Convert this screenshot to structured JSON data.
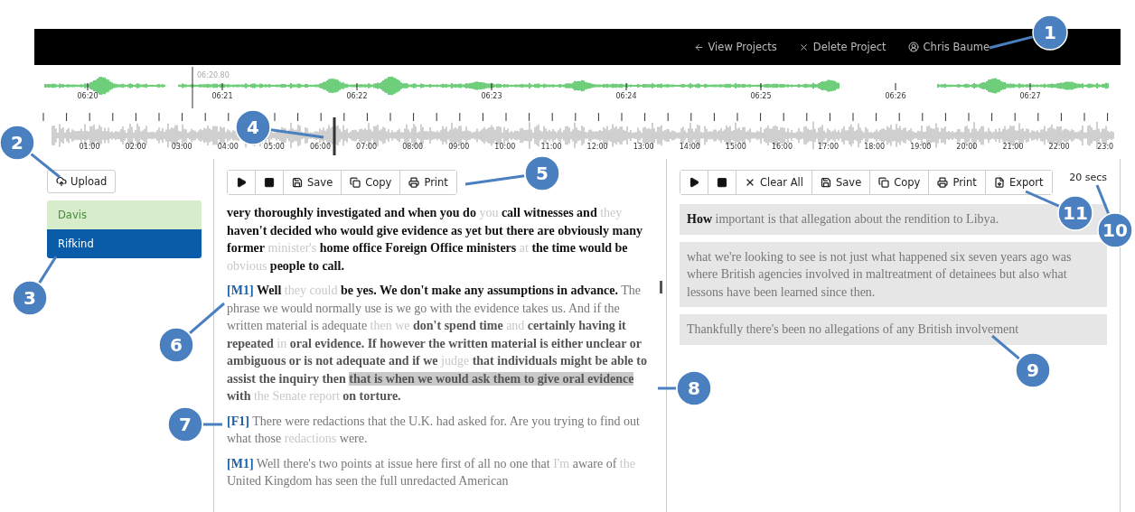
{
  "header": {
    "links": [
      {
        "kind": "back",
        "label": "View Projects"
      },
      {
        "kind": "delete",
        "label": "Delete Project"
      },
      {
        "kind": "user",
        "label": "Chris Baume"
      }
    ]
  },
  "overview": {
    "playhead_time": "06:20.80",
    "ticks": [
      "06:20",
      "06:21",
      "06:22",
      "06:23",
      "06:24",
      "06:25",
      "06:26",
      "06:27"
    ]
  },
  "timeline": {
    "ticks": [
      "01:00",
      "02:00",
      "03:00",
      "04:00",
      "05:00",
      "06:00",
      "07:00",
      "08:00",
      "09:00",
      "10:00",
      "11:00",
      "12:00",
      "13:00",
      "14:00",
      "15:00",
      "16:00",
      "17:00",
      "18:00",
      "19:00",
      "20:00",
      "21:00",
      "22:00",
      "23:0"
    ]
  },
  "upload_button": "Upload",
  "speakers": [
    {
      "name": "Davis",
      "selected": false
    },
    {
      "name": "Rifkind",
      "selected": true
    }
  ],
  "transcript": {
    "toolbar": [
      {
        "kind": "play"
      },
      {
        "kind": "stop"
      },
      {
        "kind": "save",
        "label": "Save"
      },
      {
        "kind": "copy",
        "label": "Copy"
      },
      {
        "kind": "print",
        "label": "Print"
      }
    ],
    "paragraphs": [
      {
        "segments": [
          {
            "kind": "strong",
            "text": "very thoroughly investigated and when you do"
          },
          {
            "kind": "faint",
            "text": "you"
          },
          {
            "kind": "strong",
            "text": "call witnesses and"
          },
          {
            "kind": "faint",
            "text": "they"
          },
          {
            "kind": "strong",
            "text": "haven't decided who would give evidence as yet but there are obviously many former"
          },
          {
            "kind": "faint",
            "text": "minister's"
          },
          {
            "kind": "strong",
            "text": "home office Foreign Office ministers"
          },
          {
            "kind": "faint",
            "text": "at"
          },
          {
            "kind": "strong",
            "text": "the time would be"
          },
          {
            "kind": "faint",
            "text": "obvious"
          },
          {
            "kind": "strong",
            "text": "people to call."
          }
        ]
      },
      {
        "speaker": "[M1]",
        "segments": [
          {
            "kind": "strong",
            "text": "Well"
          },
          {
            "kind": "faint",
            "text": "they could"
          },
          {
            "kind": "strong",
            "text": "be yes. We don't make any assumptions in advance."
          },
          {
            "kind": "normal",
            "text": "The phrase we would normally use is we go with the evidence takes us. And if the written material is adequate"
          },
          {
            "kind": "faint",
            "text": "then we"
          },
          {
            "kind": "medium",
            "text": "don't spend time"
          },
          {
            "kind": "faint",
            "text": "and"
          },
          {
            "kind": "medium",
            "text": "certainly having it repeated"
          },
          {
            "kind": "faint",
            "text": "in"
          },
          {
            "kind": "medium",
            "text": "oral evidence. If however the written material is either unclear or ambiguous or is not adequate and if we"
          },
          {
            "kind": "faint",
            "text": "judge"
          },
          {
            "kind": "medium",
            "text": "that individuals might be able to assist the inquiry then"
          },
          {
            "kind": "highlight",
            "text": "that is when we would ask them to give oral evidence"
          },
          {
            "kind": "medium",
            "text": "with"
          },
          {
            "kind": "faint",
            "text": "the Senate report"
          },
          {
            "kind": "medium",
            "text": "on torture."
          }
        ]
      },
      {
        "speaker": "[F1]",
        "segments": [
          {
            "kind": "normal",
            "text": "There were redactions that the U.K. had asked for. Are you trying to find out what those"
          },
          {
            "kind": "faint",
            "text": "redactions"
          },
          {
            "kind": "normal",
            "text": "were."
          }
        ]
      },
      {
        "speaker": "[M1]",
        "segments": [
          {
            "kind": "normal",
            "text": "Well there's two points at issue here first of all no one that"
          },
          {
            "kind": "faint",
            "text": "I'm"
          },
          {
            "kind": "normal",
            "text": "aware of"
          },
          {
            "kind": "faint",
            "text": "the"
          },
          {
            "kind": "normal",
            "text": "United Kingdom has seen the full unredacted American"
          }
        ]
      }
    ]
  },
  "clips": {
    "toolbar": [
      {
        "kind": "play"
      },
      {
        "kind": "stop"
      },
      {
        "kind": "clear",
        "label": "Clear All"
      },
      {
        "kind": "save",
        "label": "Save"
      },
      {
        "kind": "copy",
        "label": "Copy"
      },
      {
        "kind": "print",
        "label": "Print"
      },
      {
        "kind": "export",
        "label": "Export"
      }
    ],
    "duration": "20 secs",
    "items": [
      {
        "segments": [
          {
            "kind": "strong",
            "text": "How"
          },
          {
            "kind": "normal",
            "text": "important is that allegation about the rendition to Libya."
          }
        ]
      },
      {
        "segments": [
          {
            "kind": "normal",
            "text": "what we're looking to see is not just what happened six seven years ago was where British agencies involved in maltreatment of detainees but also what lessons have been learned since then."
          }
        ]
      },
      {
        "segments": [
          {
            "kind": "normal",
            "text": "Thankfully there's been no allegations of any British involvement"
          }
        ]
      }
    ]
  },
  "callouts": [
    {
      "number": "1"
    },
    {
      "number": "2"
    },
    {
      "number": "3"
    },
    {
      "number": "4"
    },
    {
      "number": "5"
    },
    {
      "number": "6"
    },
    {
      "number": "7"
    },
    {
      "number": "8"
    },
    {
      "number": "9"
    },
    {
      "number": "10"
    },
    {
      "number": "11"
    }
  ]
}
